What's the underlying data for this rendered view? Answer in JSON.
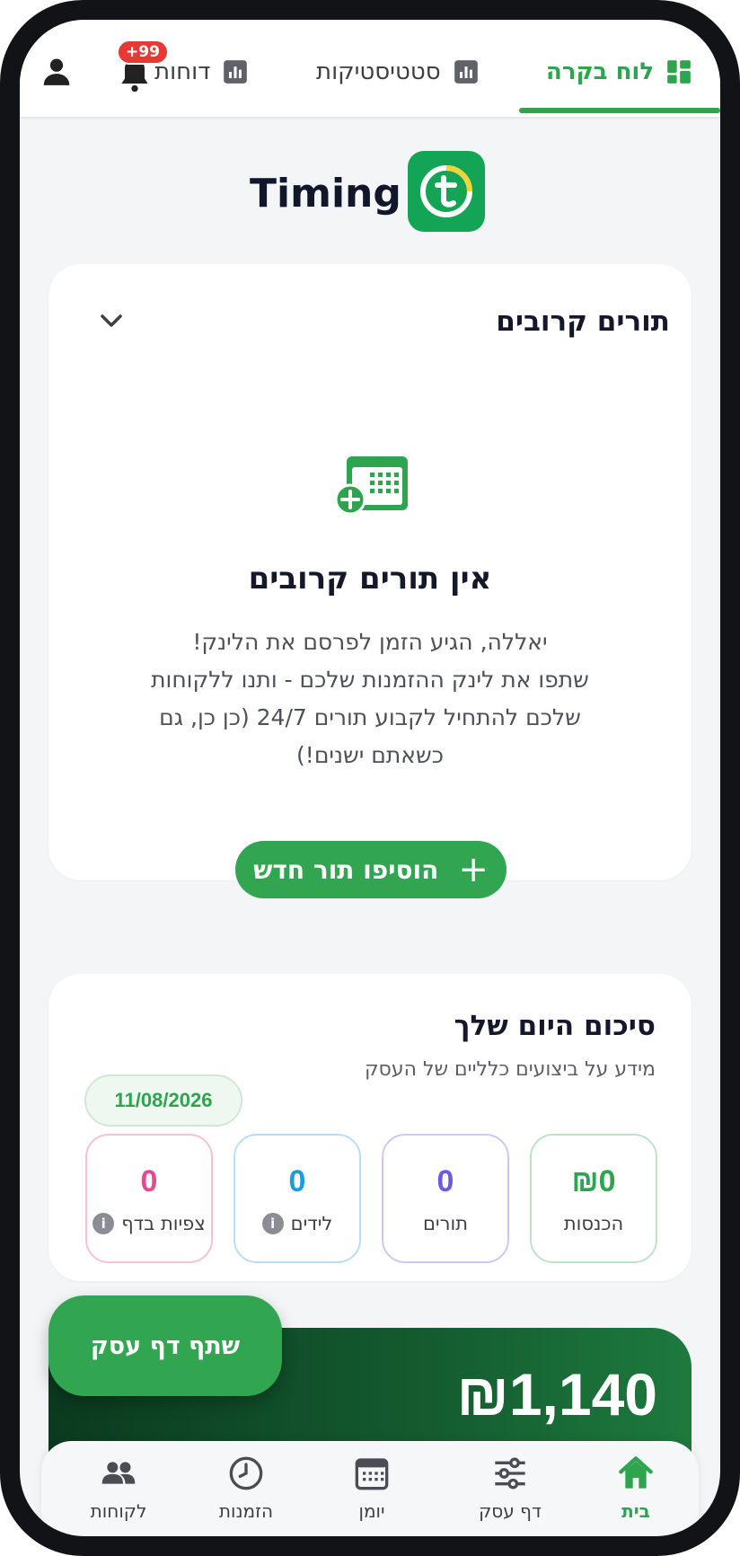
{
  "header": {
    "tabs": [
      {
        "label": "לוח בקרה",
        "icon": "dashboard-icon",
        "active": true
      },
      {
        "label": "סטטיסטיקות",
        "icon": "bar-chart-icon",
        "active": false
      },
      {
        "label": "דוחות",
        "icon": "bar-chart-icon",
        "active": false
      }
    ],
    "notification_badge": "+99",
    "accent_color": "#2fa44f"
  },
  "logo": {
    "text": "Timing",
    "icon": "timing-logo-icon"
  },
  "upcoming": {
    "title": "תורים קרובים",
    "empty_title": "אין תורים קרובים",
    "empty_lines": [
      "יאללה, הגיע הזמן לפרסם את הלינק!",
      "שתפו את לינק ההזמנות שלכם - ותנו ללקוחות",
      "שלכם להתחיל לקבוע תורים 24/7 (כן כן, גם",
      "כשאתם ישנים!)"
    ],
    "add_button": "הוסיפו תור חדש"
  },
  "summary": {
    "title": "סיכום היום שלך",
    "subtitle": "מידע על ביצועים כלליים של העסק",
    "date": "11/08/2026",
    "stats": [
      {
        "label": "הכנסות",
        "value": "₪0",
        "color": "#2fa44f",
        "border": "#bfe3c8",
        "info": false
      },
      {
        "label": "תורים",
        "value": "0",
        "color": "#6a5ce0",
        "border": "#cfc8f3",
        "info": false
      },
      {
        "label": "לידים",
        "value": "0",
        "color": "#1e9be0",
        "border": "#b9def4",
        "info": true
      },
      {
        "label": "צפיות בדף",
        "value": "0",
        "color": "#e24a91",
        "border": "#f4c2d8",
        "info": true
      }
    ]
  },
  "promo": {
    "amount": "₪1,140",
    "share_button": "שתף דף עסק"
  },
  "bottom_nav": [
    {
      "label": "בית",
      "icon": "home-icon",
      "active": true
    },
    {
      "label": "דף עסק",
      "icon": "sliders-icon",
      "active": false
    },
    {
      "label": "יומן",
      "icon": "calendar-icon",
      "active": false
    },
    {
      "label": "הזמנות",
      "icon": "clock-icon",
      "active": false
    },
    {
      "label": "לקוחות",
      "icon": "users-icon",
      "active": false
    }
  ]
}
